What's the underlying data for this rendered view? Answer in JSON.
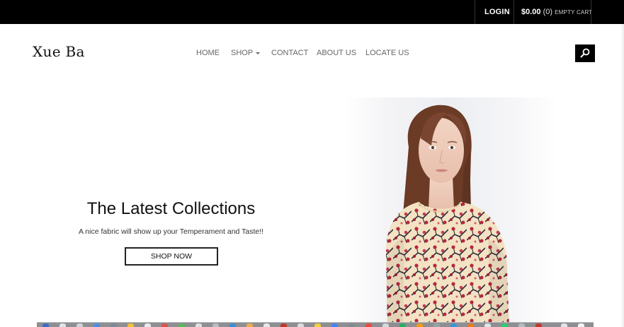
{
  "topbar": {
    "login_label": "LOGIN",
    "cart_amount": "$0.00",
    "cart_count": "(0)",
    "cart_status": "EMPTY CART"
  },
  "header": {
    "logo_text": "Xue Ba",
    "nav": [
      {
        "label": "HOME"
      },
      {
        "label": "SHOP",
        "has_dropdown": true
      },
      {
        "label": "CONTACT"
      },
      {
        "label": "ABOUT US"
      },
      {
        "label": "LOCATE US"
      }
    ],
    "search_icon": "search-icon"
  },
  "hero": {
    "title": "The Latest Collections",
    "subtitle": "A nice fabric will show up your Temperament and Taste!!",
    "button_label": "SHOP NOW",
    "image": "woman-floral-dress-photo"
  },
  "colors": {
    "topbar_bg": "#000000",
    "accent": "#000000",
    "nav_text": "#666666",
    "dress_base": "#f3e2c3",
    "dress_blossom": "#b5283e"
  }
}
